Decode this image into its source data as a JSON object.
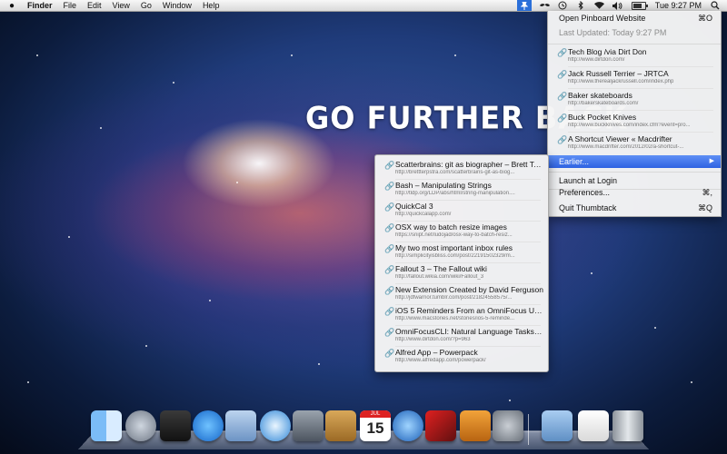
{
  "menubar": {
    "apple": "",
    "app_name": "Finder",
    "menus": [
      "File",
      "Edit",
      "View",
      "Go",
      "Window",
      "Help"
    ],
    "clock": "Tue 9:27 PM"
  },
  "wallpaper_title": "GO FURTHER BACK",
  "pinboard_menu": {
    "open_website": "Open Pinboard Website",
    "open_website_shortcut": "⌘O",
    "last_updated": "Last Updated: Today 9:27 PM",
    "bookmarks": [
      {
        "title": "Tech Blog /via Dirt Don",
        "url": "http://www.dirtdon.com/"
      },
      {
        "title": "Jack Russell Terrier – JRTCA",
        "url": "http://www.therealjackrussell.com/index.php"
      },
      {
        "title": "Baker skateboards",
        "url": "http://bakerskateboards.com/"
      },
      {
        "title": "Buck Pocket Knives",
        "url": "http://www.buckknives.com/index.cfm?event=pro..."
      },
      {
        "title": "A Shortcut Viewer « Macdrifter",
        "url": "http://www.macdrifter.com/2012/02/a-shortcut-..."
      }
    ],
    "earlier": "Earlier...",
    "launch_at_login": "Launch at Login",
    "preferences": "Preferences...",
    "preferences_shortcut": "⌘,",
    "quit": "Quit Thumbtack",
    "quit_shortcut": "⌘Q"
  },
  "earlier_menu": {
    "bookmarks": [
      {
        "title": "Scatterbrains: git as biographer – Brett Ter...",
        "url": "http://brettterpstra.com/scatterbrains-git-as-biog..."
      },
      {
        "title": "Bash – Manipulating Strings",
        "url": "http://tldp.org/LDP/abs/html/string-manipulation...."
      },
      {
        "title": "QuickCal 3",
        "url": "http://quickcalapp.com/"
      },
      {
        "title": "OSX way to batch resize images",
        "url": "https://snipt.net/ludojad/osx-way-to-batch-resiz..."
      },
      {
        "title": "My two most important inbox rules",
        "url": "http://simplicityisbliss.com/post/22191502329/m..."
      },
      {
        "title": "Fallout 3 – The Fallout wiki",
        "url": "http://fallout.wikia.com/wiki/Fallout_3"
      },
      {
        "title": "New Extension Created by David Ferguson",
        "url": "http://jdfwarrior.tumblr.com/post/21824558575/..."
      },
      {
        "title": "iOS 5 Reminders From an OmniFocus User'...",
        "url": "http://www.macstories.net/stories/ios-5-reminde..."
      },
      {
        "title": "OmniFocusCLI: Natural Language Tasks fro...",
        "url": "http://www.dirtdon.com/?p=963"
      },
      {
        "title": "Alfred App – Powerpack",
        "url": "http://www.alfredapp.com/powerpack/"
      }
    ]
  },
  "dock": {
    "calendar_month": "JUL",
    "calendar_day": "15",
    "items": [
      "finder-icon",
      "launchpad-icon",
      "photo-booth-icon",
      "app-store-icon",
      "mail-icon",
      "safari-icon",
      "facetime-icon",
      "address-book-icon",
      "calendar-icon",
      "itunes-icon",
      "photo-booth-strip-icon",
      "iphoto-icon",
      "system-preferences-icon",
      "downloads-folder-icon",
      "documents-stack-icon",
      "trash-icon"
    ]
  }
}
